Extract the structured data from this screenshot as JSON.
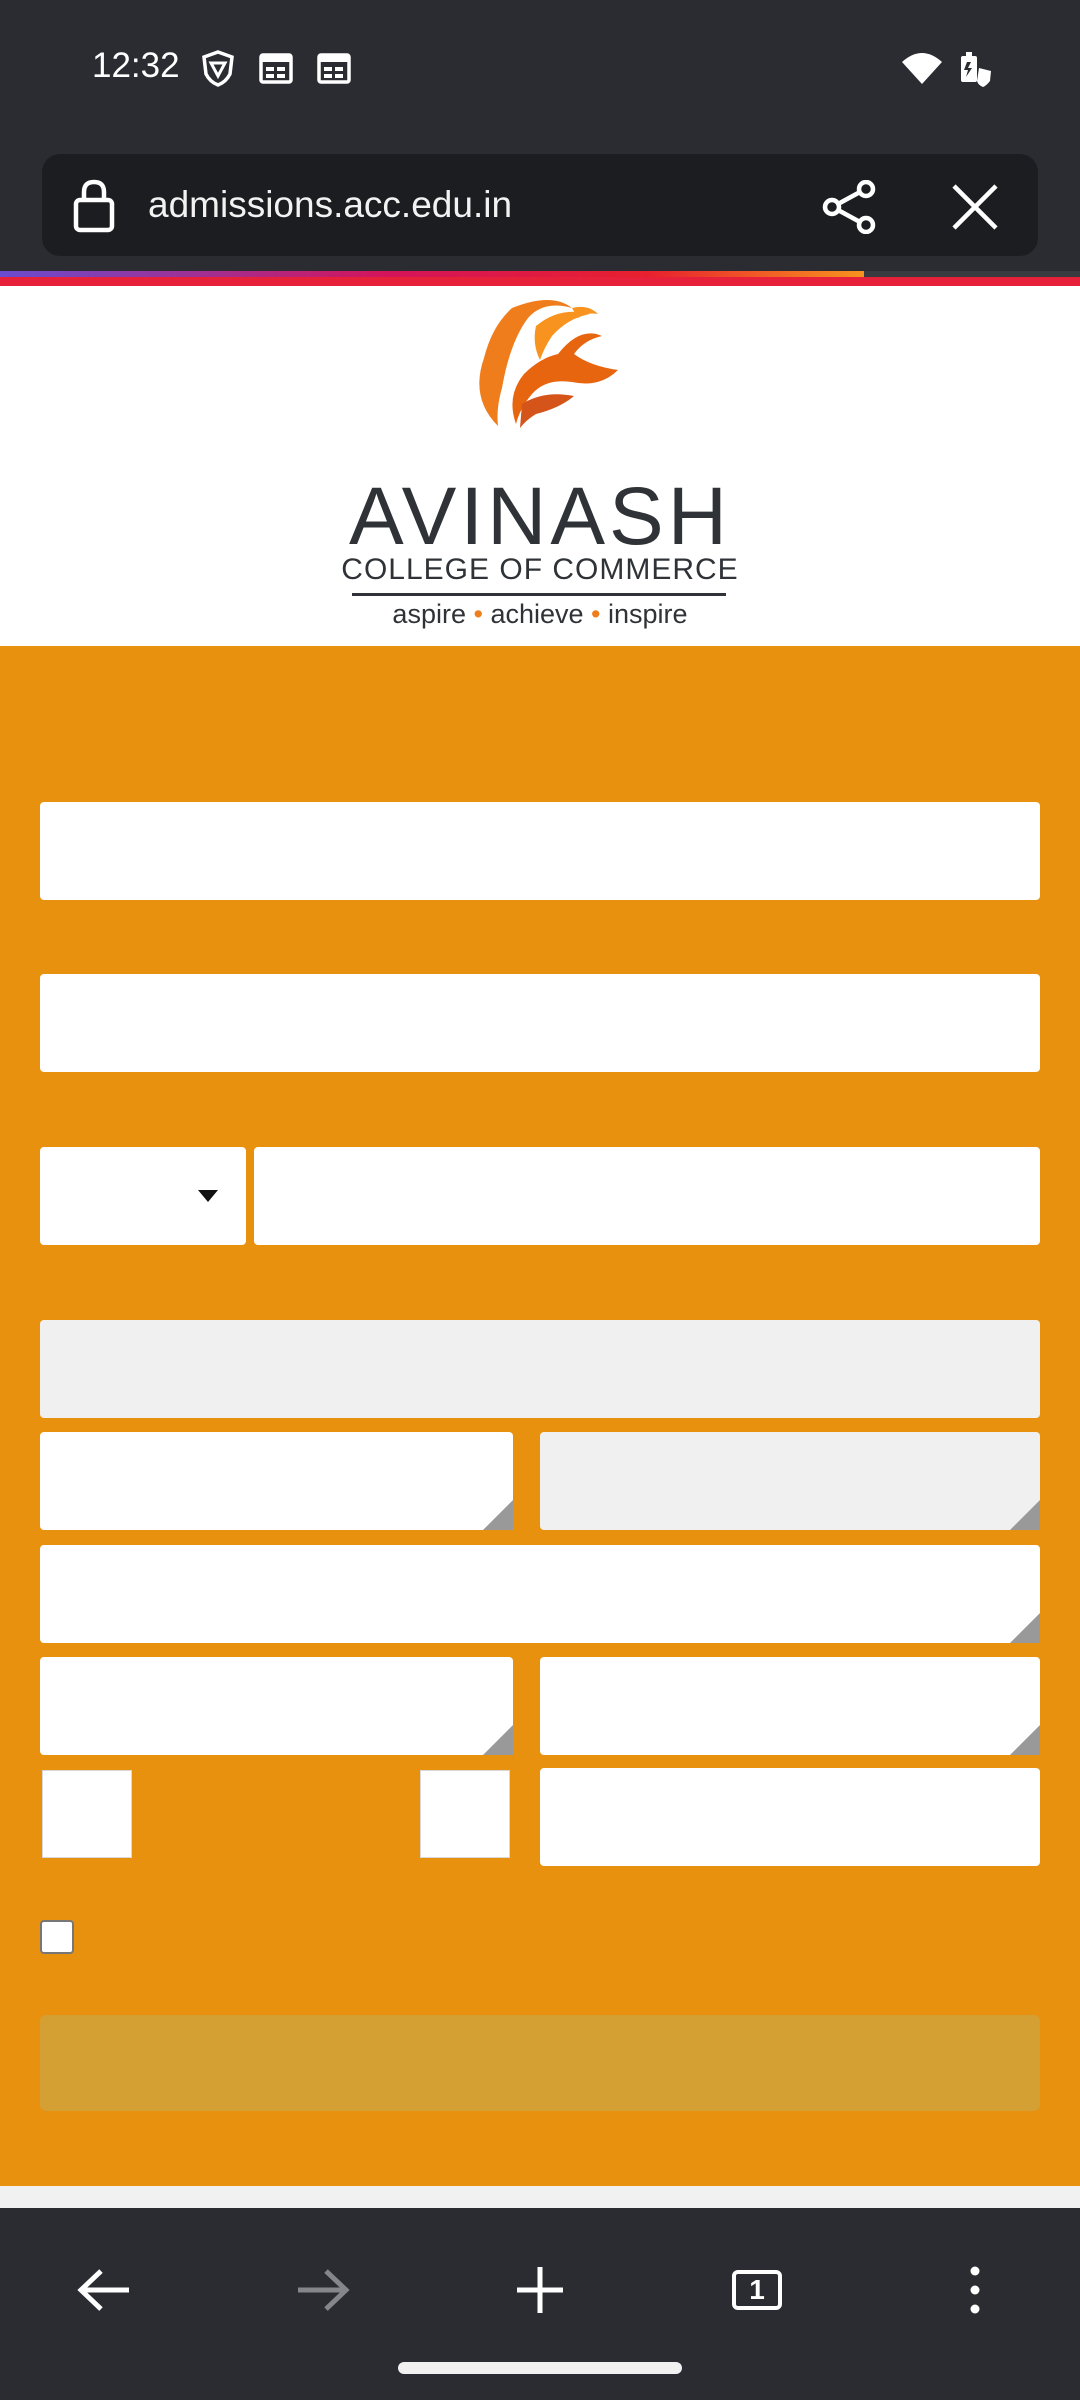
{
  "status_bar": {
    "time": "12:32",
    "left_icons": [
      "vpn-shield-icon",
      "calendar-icon",
      "calendar-icon"
    ],
    "right_icons": [
      "wifi-icon",
      "battery-saver-icon"
    ]
  },
  "browser": {
    "url": "admissions.acc.edu.in",
    "left_icon": "lock-icon",
    "share_icon": "share-icon",
    "close_icon": "close-icon",
    "load_progress": 0.8,
    "tab_count": "1"
  },
  "logo": {
    "name": "AVINASH",
    "subtitle": "COLLEGE OF COMMERCE",
    "tagline_words": [
      "aspire",
      "achieve",
      "inspire"
    ],
    "separator": "•"
  },
  "form": {
    "fields": [
      {
        "name": "field-1",
        "value": "",
        "placeholder": ""
      },
      {
        "name": "field-2",
        "value": "",
        "placeholder": ""
      },
      {
        "name": "country-code",
        "value": ""
      },
      {
        "name": "phone",
        "value": "",
        "placeholder": ""
      },
      {
        "name": "disabled-field",
        "value": ""
      },
      {
        "name": "textarea-1",
        "value": ""
      },
      {
        "name": "textarea-2",
        "value": ""
      },
      {
        "name": "textarea-3",
        "value": ""
      },
      {
        "name": "textarea-4",
        "value": ""
      },
      {
        "name": "textarea-5",
        "value": ""
      },
      {
        "name": "captcha-input",
        "value": ""
      }
    ],
    "submit_label": ""
  },
  "colors": {
    "form_background": "#e8910f",
    "submit_background": "#d4a033",
    "logo_orange": "#f07d1c",
    "logo_dark": "#2f3337",
    "chrome_background": "#2b2c31"
  }
}
